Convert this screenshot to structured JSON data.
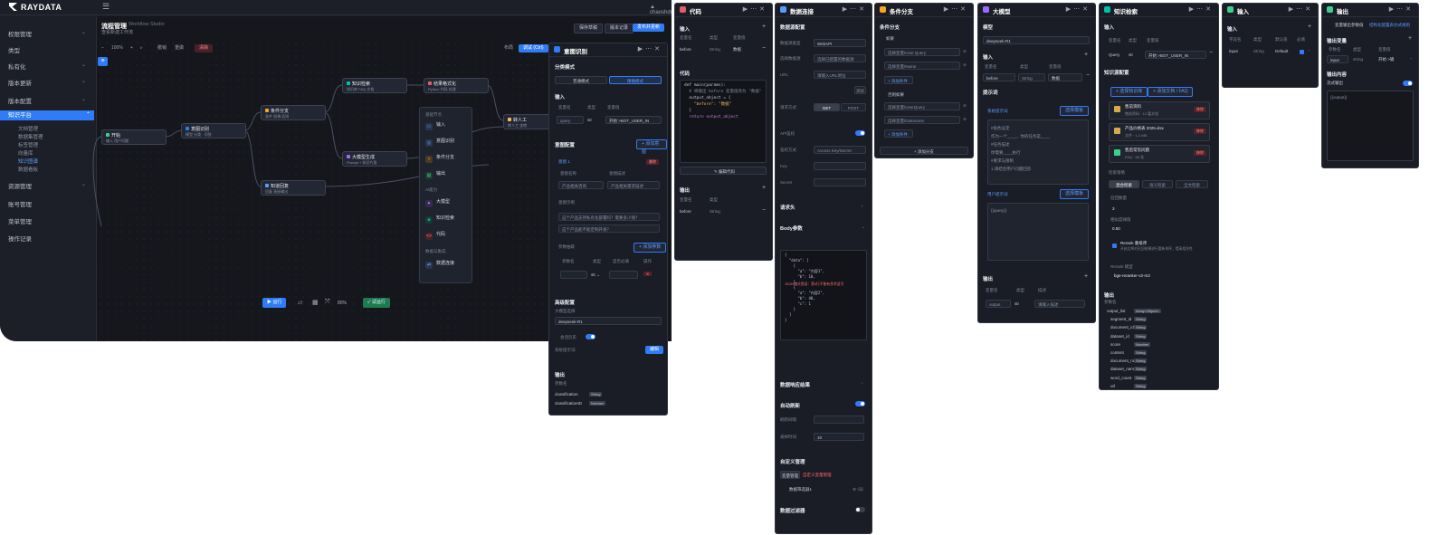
{
  "app": {
    "name": "RAYDATA",
    "user": "chaoshdr"
  },
  "sidebar": {
    "items": [
      {
        "label": "权限管理"
      },
      {
        "label": "类型"
      },
      {
        "label": "私有化"
      },
      {
        "label": "版本更新"
      },
      {
        "label": "版本配置"
      },
      {
        "label": "知识平台"
      },
      {
        "label": "资源管理"
      },
      {
        "label": "账号管理"
      },
      {
        "label": "菜单管理"
      },
      {
        "label": "操作记录"
      }
    ],
    "subitems": [
      {
        "label": "文档管理"
      },
      {
        "label": "数据集管理"
      },
      {
        "label": "标签管理"
      },
      {
        "label": "向量库"
      },
      {
        "label": "知识图谱"
      },
      {
        "label": "数据看板"
      }
    ]
  },
  "header": {
    "title": "流程管理",
    "subtitle": "Workflow Studio",
    "desc": "查看新建工作流",
    "btn_publish": "保存草稿",
    "btn_history": "版本记录",
    "btn_run": "发布并更新"
  },
  "toolbar": {
    "zoom": "100%",
    "undo": "撤销",
    "redo": "重做",
    "clear": "清除",
    "layout": "布局",
    "debug": "调试 (Ctrl)"
  },
  "nodes": [
    {
      "title": "开始",
      "desc": "输入 用户问题",
      "color": "#3ecf8e"
    },
    {
      "title": "意图识别",
      "desc": "模型 分类 · 问答",
      "color": "#2f7cf6"
    },
    {
      "title": "条件分支",
      "desc": "条件 如果/否则",
      "color": "#f5a623"
    },
    {
      "title": "知识检索",
      "desc": "知识库 FAQ 文档",
      "color": "#00c2a8"
    },
    {
      "title": "结果格式化",
      "desc": "Python 代码 处理",
      "color": "#e35d6a"
    },
    {
      "title": "大模型生成",
      "desc": "Prompt + 知识片段",
      "color": "#9b6bff"
    },
    {
      "title": "转人工",
      "desc": "转人工 坐席",
      "color": "#ffb74d"
    },
    {
      "title": "知道回复",
      "desc": "回复 直接输出",
      "color": "#5b9bff"
    }
  ],
  "palette": {
    "sec1": "基础节点",
    "sec2": "AI能力",
    "sec3": "数据与集成",
    "items": [
      {
        "label": "输入",
        "color": "#2f7cf6"
      },
      {
        "label": "意图识别",
        "color": "#2f7cf6"
      },
      {
        "label": "条件分支",
        "color": "#f5a623"
      },
      {
        "label": "输出",
        "color": "#3ecf8e"
      },
      {
        "label": "大模型",
        "color": "#9b6bff"
      },
      {
        "label": "知识检索",
        "color": "#00c2a8"
      },
      {
        "label": "代码",
        "color": "#e35d6a"
      },
      {
        "label": "数据连接",
        "color": "#5b9bff"
      }
    ]
  },
  "bottombar": {
    "run": "运行",
    "zoom": "80%",
    "publish": "试运行"
  },
  "p_intent": {
    "title": "意图识别",
    "mode_label": "分类模式",
    "mode_a": "普通模式",
    "mode_b": "精确模式",
    "input_label": "输入",
    "col1": "变量名",
    "col2": "类型",
    "col3": "变量值",
    "var": "query",
    "type": "str",
    "val": "开始 >BOT_USER_IN",
    "cfg_label": "意图配置",
    "cfg_add": "+ 添加意图",
    "intent1": "意图 1",
    "del": "删除",
    "desc_label": "意图名称",
    "desc_label2": "意图描述",
    "ph1": "产品相关咨询",
    "ph2": "产品相关需求描述",
    "ex_label": "意图示例",
    "ex1": "这个产品支持私有化部署吗？需要多少钱？",
    "ex2": "这个产品能不能定制开发？",
    "param_label": "参数抽取",
    "param_add": "+ 添加参数",
    "pc1": "参数名",
    "pc2": "类型",
    "pc3": "是否必填",
    "pc4": "操作",
    "adv_label": "高级配置",
    "model_label": "大模型选择",
    "model": "deepseek-R1",
    "hist": "会话历史",
    "sys": "系统提示词",
    "sys_btn": "编辑",
    "out_label": "输出",
    "out_col": "参数名",
    "o1": "classification",
    "o1t": "String",
    "o2": "classificationID",
    "o2t": "Number"
  },
  "p_code": {
    "title": "代码",
    "in_label": "输入",
    "c1": "变量名",
    "c2": "类型",
    "c3": "变量值",
    "var": "before",
    "type": "String",
    "val": "数据",
    "code_label": "代码",
    "code1": "def main(params):",
    "code2": "  # 将输出 before 变量值改为 \"数据\"",
    "code3": "  output_object = {",
    "code4": "    \"before\": \"数据\"",
    "code5": "  }",
    "code6": "  return output_object",
    "edit": "编辑代码",
    "out_label": "输出",
    "oc1": "变量名",
    "oc2": "类型",
    "ov": "before",
    "ot": "String"
  },
  "p_data": {
    "title": "数据连接",
    "s1": "数据源配置",
    "l1": "数据源类型",
    "v1": "WebAPI",
    "l2": "选择数据源",
    "v2": "选择已配置的数据源",
    "l3": "URL",
    "v3": "请输入URL地址",
    "test": "测试",
    "l4": "请求方式",
    "get": "GET",
    "post": "POST",
    "l5": "API鉴权",
    "l6": "鉴权方式",
    "v6": "Access Key/Secret",
    "l7": "Key",
    "l8": "Secret",
    "s2": "请求头",
    "s3": "Body参数",
    "json1": "{",
    "json2": "  \"data\": [",
    "json3": "    {",
    "json4": "      \"a\": \"内容1\",",
    "json5": "      \"b\": 10,",
    "json6": "    },",
    "json7": "    {",
    "json8": "      \"a\": \"内容2\",",
    "json9": "      \"b\": 40,",
    "json10": "      \"c\": 1",
    "json11": "    }",
    "json12": "  ]",
    "json13": "}",
    "err": "JSON格式错误：第4行不能有多余逗号",
    "s4": "数据响应结果",
    "s5": "自动刷新",
    "l9": "刷新间隔",
    "l10": "采样时间",
    "v10": "10",
    "s6": "自定义管理",
    "tab1": "变量管理",
    "tab2": "自定义变量管理",
    "l11": "数据筛选器1",
    "s7": "数据过滤器"
  },
  "p_cond": {
    "title": "条件分支",
    "s1": "条件分支",
    "if": "如果",
    "f1": "选择变量/User.Query",
    "f2": "选择变量/Name",
    "add1": "+ 添加条件",
    "elif": "否则如果",
    "f3": "选择变量/UserQuery",
    "f4": "选择变量/Datename",
    "add2": "+ 添加条件",
    "add3": "+ 添加分支"
  },
  "p_llm": {
    "title": "大模型",
    "m_label": "模型",
    "model": "deepseek-R1",
    "in_label": "输入",
    "c1": "变量名",
    "c2": "类型",
    "c3": "变量值",
    "var": "before",
    "type": "String",
    "val": "数据",
    "prompt_label": "提示词",
    "sys": "系统提示词",
    "tpl": "选择模板",
    "t1": "#角色设定",
    "t2": "作为一个____，你的任务是____",
    "t3": "#任务描述",
    "t4": "你需要____执行",
    "t5": "#要求与限制",
    "t6": "1.请结合用户问题回答",
    "user": "用户提示词",
    "tpl2": "选择模板",
    "t7": "{{query}}",
    "out_label": "输出",
    "oc1": "变量名",
    "oc2": "类型",
    "oc3": "描述",
    "ov": "output",
    "ot": "str",
    "od": "请输入描述"
  },
  "p_kb": {
    "title": "知识检索",
    "in_label": "输入",
    "c1": "变量名",
    "c2": "类型",
    "c3": "变量值",
    "var": "Query",
    "type": "str",
    "val": "开始 >BOT_USER_IN",
    "src_label": "知识源配置",
    "b1": "+ 选择知识库",
    "b2": "+ 添加文档 / FAQ",
    "k1": "售前资料",
    "k1d": "售前资料 · 12 篇文档",
    "k2": "产品价格表 2025.xlsx",
    "k2d": "文件 · 1.2 MB",
    "k3": "售后常见问题",
    "k3d": "FAQ · 86 条",
    "rm": "移除",
    "strat": "检索策略",
    "m1": "混合检索",
    "m2": "语义检索",
    "m3": "全文检索",
    "topk": "召回数量",
    "topk_v": "3",
    "score": "相似度阈值",
    "score_v": "0.50",
    "rerank": "Rerank 重排序",
    "rerank_d": "开启后将对召回结果进行重新排序，提高相关性",
    "rerank_model_l": "Rerank 模型",
    "rerank_model": "bge-reranker-v2-m3",
    "out_label": "输出",
    "out_col": "参数名",
    "outputs": [
      {
        "n": "output_list",
        "t": "Array<Object>"
      },
      {
        "n": "segment_id",
        "t": "String"
      },
      {
        "n": "document_id",
        "t": "String"
      },
      {
        "n": "dataset_id",
        "t": "String"
      },
      {
        "n": "score",
        "t": "Number"
      },
      {
        "n": "content",
        "t": "String"
      },
      {
        "n": "document_name",
        "t": "String"
      },
      {
        "n": "dataset_name",
        "t": "String"
      },
      {
        "n": "word_count",
        "t": "String"
      },
      {
        "n": "url",
        "t": "String"
      }
    ]
  },
  "p_input": {
    "title": "输入",
    "in_label": "输入",
    "c1": "字段名",
    "c2": "类型",
    "c3": "默认值",
    "c4": "必填",
    "var": "input",
    "type": "String",
    "def": "Default"
  },
  "p_out": {
    "title": "输出",
    "tab1": "变量输出参数值",
    "tab2": "结构化配置表达式规则",
    "s1": "输出变量",
    "c1": "参数名",
    "c2": "类型",
    "c3": "变量值",
    "var": "input",
    "type": "string",
    "val": "开始 >输",
    "s2": "输出内容",
    "stream": "流式输出",
    "ph": "{{output}}"
  }
}
